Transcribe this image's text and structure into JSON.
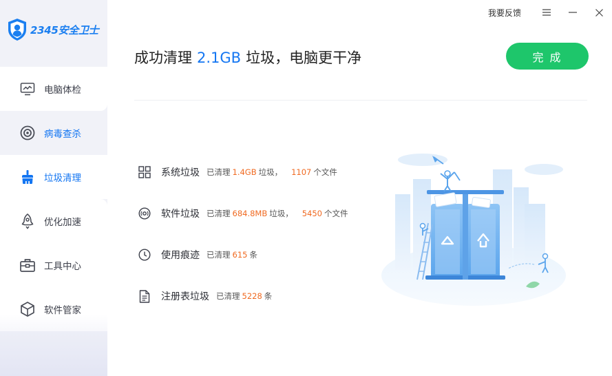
{
  "app": {
    "logo_text": "2345安全卫士"
  },
  "topbar": {
    "feedback_label": "我要反馈",
    "menu_icon": "hamburger-menu-icon",
    "minimize_icon": "minimize-icon",
    "close_icon": "close-icon"
  },
  "sidebar": {
    "items": [
      {
        "label": "电脑体检",
        "icon": "monitor-icon"
      },
      {
        "label": "病毒查杀",
        "icon": "target-icon"
      },
      {
        "label": "垃圾清理",
        "icon": "broom-icon"
      },
      {
        "label": "优化加速",
        "icon": "rocket-icon"
      },
      {
        "label": "工具中心",
        "icon": "toolbox-icon"
      },
      {
        "label": "软件管家",
        "icon": "cube-icon"
      }
    ]
  },
  "header": {
    "prefix": "成功清理",
    "size": "2.1GB",
    "suffix": "垃圾，电脑更干净",
    "done_label": "完 成"
  },
  "results": [
    {
      "name": "系统垃圾",
      "cleaned_prefix": "已清理",
      "size": "1.4GB",
      "size_unit": "垃圾，",
      "count": "1107",
      "count_unit": "个文件",
      "icon": "grid-icon"
    },
    {
      "name": "软件垃圾",
      "cleaned_prefix": "已清理",
      "size": "684.8MB",
      "size_unit": "垃圾，",
      "count": "5450",
      "count_unit": "个文件",
      "icon": "disc-icon"
    },
    {
      "name": "使用痕迹",
      "cleaned_prefix": "已清理",
      "count": "615",
      "count_unit": "条",
      "icon": "clock-icon"
    },
    {
      "name": "注册表垃圾",
      "cleaned_prefix": "已清理",
      "count": "5228",
      "count_unit": "条",
      "icon": "document-icon"
    }
  ],
  "colors": {
    "accent_blue": "#1476f2",
    "done_green": "#1ec66b",
    "number_orange": "#f06a21",
    "sidebar_bg": "#f1f2f8"
  }
}
